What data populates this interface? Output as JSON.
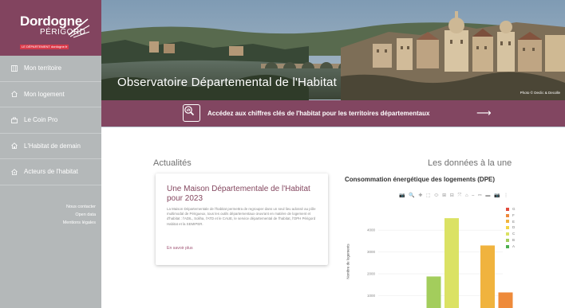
{
  "brand": {
    "line1": "Dordogne",
    "line2": "PÉRIGORD",
    "line3": "LE DÉPARTEMENT  dordogne.fr"
  },
  "sidebar": {
    "items": [
      {
        "label": "Mon territoire",
        "icon": "map-icon"
      },
      {
        "label": "Mon logement",
        "icon": "home-icon"
      },
      {
        "label": "Le Coin Pro",
        "icon": "briefcase-icon"
      },
      {
        "label": "L'Habitat de demain",
        "icon": "house-future-icon"
      },
      {
        "label": "Acteurs de l'habitat",
        "icon": "people-home-icon"
      }
    ],
    "links": [
      "Nous contacter",
      "Open data",
      "Mentions légales"
    ]
  },
  "hero": {
    "title": "Observatoire Départemental de l'Habitat",
    "credit": "Photo © Declic & Decolle"
  },
  "banner": {
    "text": "Accédez aux chiffres clés de l'habitat pour les territoires départementaux",
    "arrow": "⟶"
  },
  "news": {
    "section_title": "Actualités",
    "card_title": "Une Maison Départementale de l'Habitat pour 2023",
    "card_body": "La Maison Départementale de l'habitat permettra de regrouper dans un seul lieu adossé au pôle multimodal de Périgueux, tous les outils départementaux œuvrant en matière de logement et d'habitat : l'ADIL, Soliha, l'ATD et le CAUE, le service départemental de l'habitat, l'OPH Périgord Habitat et la SEMIPER.",
    "card_link": "En savoir plus"
  },
  "data_section": {
    "title": "Les données à la une"
  },
  "chart_toolbar": "📷 🔍 ✚ ⬚ ⬭ ⊞ ⊟ ⤧ ⌂ ⎯ ⎓ ▬ 📷 ⋮",
  "colors": {
    "brand": "#82445f",
    "sidebar": "#b4b8b9"
  },
  "chart_data": {
    "type": "bar",
    "title": "Consommation énergétique des logements (DPE)",
    "ylabel": "Nombre de logements",
    "yticks": [
      1000,
      2000,
      3000,
      4000
    ],
    "ylim": [
      0,
      4700
    ],
    "series": [
      {
        "name": "G",
        "color": "#e14b3c",
        "x": 6,
        "value": 0
      },
      {
        "name": "F",
        "color": "#ee8a3a",
        "x": 5,
        "value": 1150
      },
      {
        "name": "E",
        "color": "#f0b33e",
        "x": 4,
        "value": 3300
      },
      {
        "name": "D",
        "color": "#f2d444",
        "x": 3,
        "value": 0
      },
      {
        "name": "C",
        "color": "#dbe264",
        "x": 2,
        "value": 4550
      },
      {
        "name": "B",
        "color": "#a3cd5c",
        "x": 1,
        "value": 1880
      },
      {
        "name": "A",
        "color": "#4caf50",
        "x": 0,
        "value": 0
      }
    ]
  }
}
